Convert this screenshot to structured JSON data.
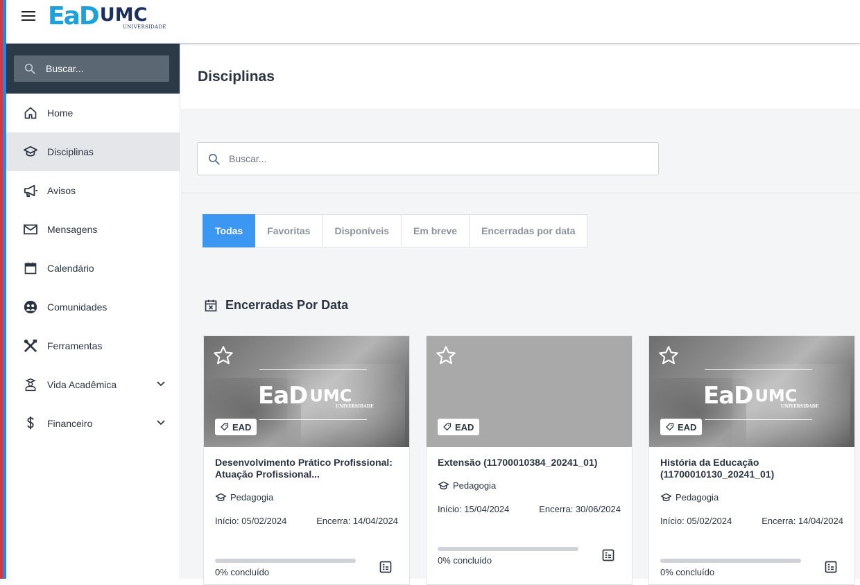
{
  "brand": {
    "logo_ead": "EaD",
    "logo_umc": "UMC",
    "logo_sub": "UNIVERSIDADE"
  },
  "sidebar": {
    "search_placeholder": "Buscar...",
    "items": [
      {
        "label": "Home",
        "icon": "home-icon"
      },
      {
        "label": "Disciplinas",
        "icon": "graduation-cap-icon",
        "active": true
      },
      {
        "label": "Avisos",
        "icon": "megaphone-icon"
      },
      {
        "label": "Mensagens",
        "icon": "envelope-icon"
      },
      {
        "label": "Calendário",
        "icon": "calendar-icon"
      },
      {
        "label": "Comunidades",
        "icon": "community-icon"
      },
      {
        "label": "Ferramentas",
        "icon": "tools-icon"
      },
      {
        "label": "Vida Acadêmica",
        "icon": "student-icon",
        "expandable": true
      },
      {
        "label": "Financeiro",
        "icon": "dollar-icon",
        "expandable": true
      }
    ]
  },
  "main": {
    "title": "Disciplinas",
    "search_placeholder": "Buscar...",
    "tabs": [
      {
        "label": "Todas",
        "active": true
      },
      {
        "label": "Favoritas"
      },
      {
        "label": "Disponíveis"
      },
      {
        "label": "Em breve"
      },
      {
        "label": "Encerradas por data"
      }
    ],
    "section_title": "Encerradas Por Data",
    "cards": [
      {
        "title": "Desenvolvimento Prático Profissional: Atuação Profissional...",
        "tag": "EAD",
        "course": "Pedagogia",
        "inicio": "Início: 05/02/2024",
        "encerra": "Encerra: 14/04/2024",
        "progress": 0,
        "progress_text": "0% concluído",
        "has_photo": true
      },
      {
        "title": "Extensão (11700010384_20241_01)",
        "tag": "EAD",
        "course": "Pedagogia",
        "inicio": "Início: 15/04/2024",
        "encerra": "Encerra: 30/06/2024",
        "progress": 0,
        "progress_text": "0% concluído",
        "has_photo": false
      },
      {
        "title": "História da Educação (11700010130_20241_01)",
        "tag": "EAD",
        "course": "Pedagogia",
        "inicio": "Início: 05/02/2024",
        "encerra": "Encerra: 14/04/2024",
        "progress": 0,
        "progress_text": "0% concluído",
        "has_photo": true
      }
    ]
  },
  "colors": {
    "accent": "#3b97f2",
    "sidebar_dark": "#2c3a47",
    "brand_blue": "#1ea0d8",
    "brand_navy": "#1d2f5c"
  }
}
